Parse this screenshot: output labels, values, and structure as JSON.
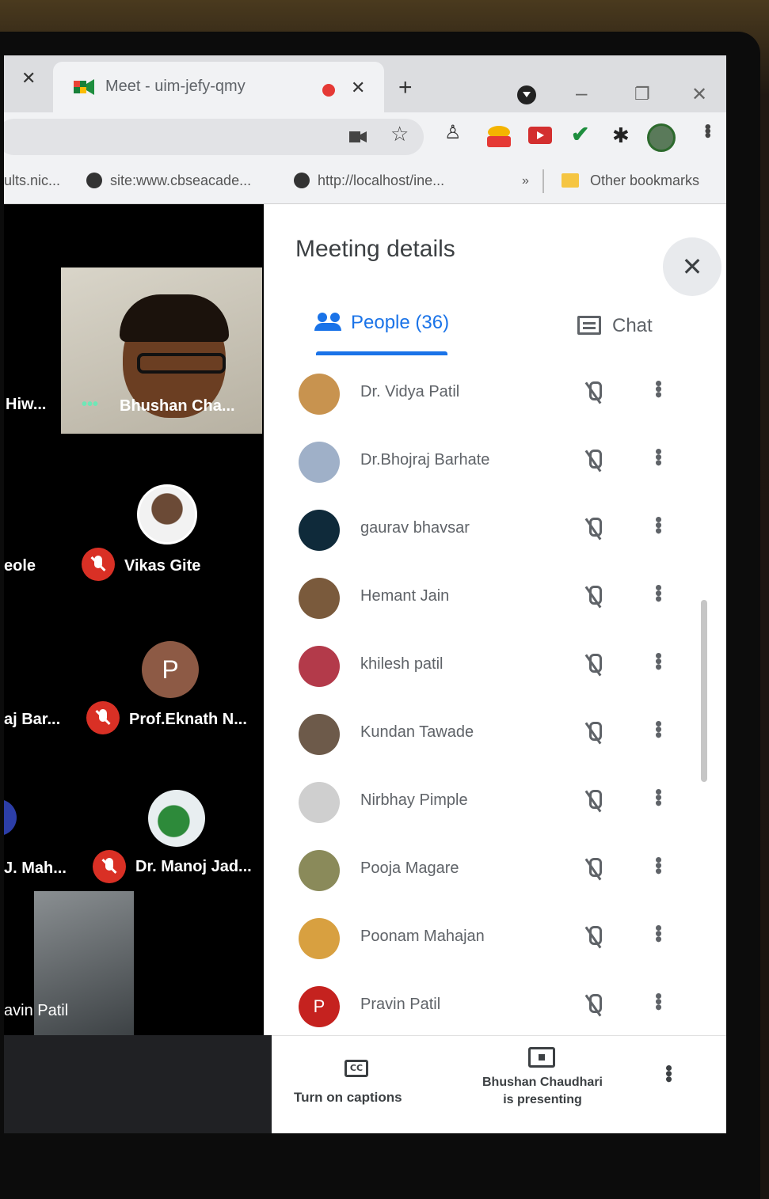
{
  "browser": {
    "tab": {
      "title": "Meet - uim-jefy-qmy"
    },
    "bookmarks": [
      {
        "label": "ults.nic..."
      },
      {
        "label": "site:www.cbseacade..."
      },
      {
        "label": "http://localhost/ine..."
      }
    ],
    "bookmarks_overflow": "»",
    "other_bookmarks": "Other bookmarks"
  },
  "grid": {
    "tiles": [
      {
        "name": "Hiw..."
      },
      {
        "name": "Bhushan Cha..."
      },
      {
        "name": "eole"
      },
      {
        "name": "Vikas Gite"
      },
      {
        "name": "aj Bar..."
      },
      {
        "name": "Prof.Eknath N..."
      },
      {
        "name": "J. Mah..."
      },
      {
        "name": "Dr. Manoj Jad..."
      },
      {
        "name": "avin Patil"
      }
    ],
    "p_initial": "P"
  },
  "panel": {
    "title": "Meeting details",
    "close_symbol": "✕",
    "tabs": {
      "people": "People (36)",
      "chat": "Chat"
    },
    "people": [
      {
        "name": "Dr. Vidya Patil",
        "avatar_color": "#c8934f"
      },
      {
        "name": "Dr.Bhojraj Barhate",
        "avatar_color": "#9fb0c8"
      },
      {
        "name": "gaurav bhavsar",
        "avatar_color": "#0f2a3a"
      },
      {
        "name": "Hemant Jain",
        "avatar_color": "#7a5a3c"
      },
      {
        "name": "khilesh patil",
        "avatar_color": "#b33a4a"
      },
      {
        "name": "Kundan Tawade",
        "avatar_color": "#6d5a4a"
      },
      {
        "name": "Nirbhay Pimple",
        "avatar_color": "#cfcfcf"
      },
      {
        "name": "Pooja Magare",
        "avatar_color": "#8a8a5a"
      },
      {
        "name": "Poonam Mahajan",
        "avatar_color": "#d8a040"
      },
      {
        "name": "Pravin Patil",
        "avatar_color": "#c5221f",
        "initial": "P"
      }
    ]
  },
  "bottom_bar": {
    "captions_label": "Turn on captions",
    "cc_icon_text": "CC",
    "presenting_line1": "Bhushan Chaudhari",
    "presenting_line2": "is presenting"
  }
}
